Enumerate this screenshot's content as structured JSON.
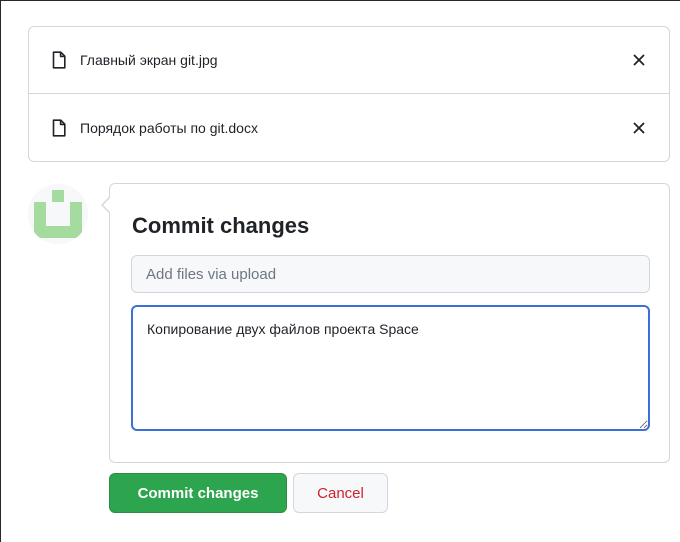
{
  "files": [
    {
      "name": "Главный экран git.jpg",
      "icon": "file-icon",
      "remove_icon": "close-icon"
    },
    {
      "name": "Порядок работы по git.docx",
      "icon": "file-icon",
      "remove_icon": "close-icon"
    }
  ],
  "commit": {
    "title": "Commit changes",
    "summary_placeholder": "Add files via upload",
    "summary_value": "",
    "description_value": "Копирование двух файлов проекта Space"
  },
  "buttons": {
    "commit_label": "Commit changes",
    "cancel_label": "Cancel"
  },
  "colors": {
    "commit_green": "#2da44e",
    "cancel_red": "#cf222e",
    "focus_blue": "#3c6fd8",
    "avatar_green": "#a6dba0"
  }
}
